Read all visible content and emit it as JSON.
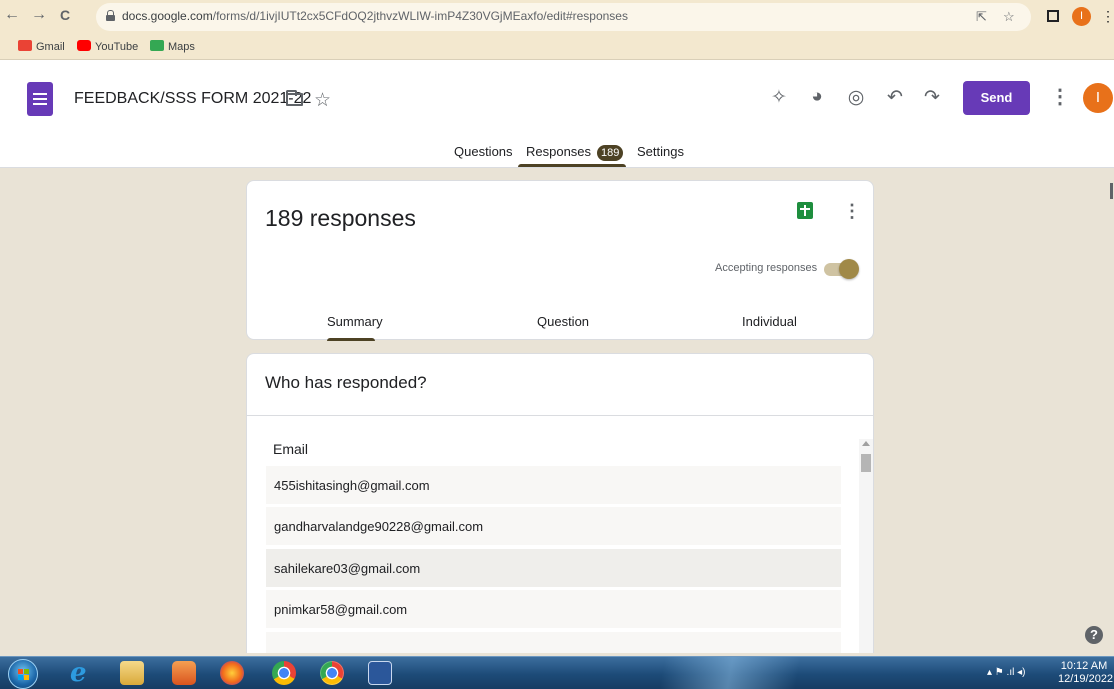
{
  "browser": {
    "url_domain": "docs.google.com",
    "url_path": "/forms/d/1ivjIUTt2cx5CFdOQ2jthvzWLIW-imP4Z30VGjMEaxfo/edit#responses",
    "nav": {
      "back": "←",
      "forward": "→",
      "reload": "C"
    },
    "icons": [
      "lock-icon",
      "share-icon",
      "bookmark-star-icon",
      "window-icon",
      "profile-icon",
      "menu-icon"
    ],
    "profile_initial": "I",
    "bookmarks": [
      {
        "label": "Gmail",
        "color": "#ea4335"
      },
      {
        "label": "YouTube",
        "color": "#ff0000"
      },
      {
        "label": "Maps",
        "color": "#34a853"
      }
    ]
  },
  "header": {
    "doc_title": "FEEDBACK/SSS FORM 2021-22",
    "send_label": "Send",
    "avatar_initial": "I",
    "accent_color": "#673ab7",
    "tool_icons": [
      "addon-icon",
      "palette-icon",
      "preview-icon",
      "undo-icon",
      "redo-icon"
    ],
    "tabs": [
      {
        "label": "Questions"
      },
      {
        "label": "Responses",
        "count": "189",
        "active": true
      },
      {
        "label": "Settings"
      }
    ]
  },
  "responses_card": {
    "title": "189 responses",
    "accepting_label": "Accepting responses",
    "accepting": true,
    "subtabs": [
      {
        "label": "Summary",
        "active": true
      },
      {
        "label": "Question"
      },
      {
        "label": "Individual"
      }
    ]
  },
  "who_card": {
    "title": "Who has responded?",
    "column_header": "Email",
    "emails": [
      "455ishitasingh@gmail.com",
      "gandharvalandge90228@gmail.com",
      "sahilekare03@gmail.com",
      "pnimkar58@gmail.com"
    ]
  },
  "taskbar": {
    "time": "10:12 AM",
    "date": "12/19/2022",
    "apps": [
      "internet-explorer-icon",
      "file-explorer-icon",
      "media-player-icon",
      "firefox-icon",
      "chrome-icon",
      "chrome-profile-icon",
      "word-icon"
    ]
  }
}
